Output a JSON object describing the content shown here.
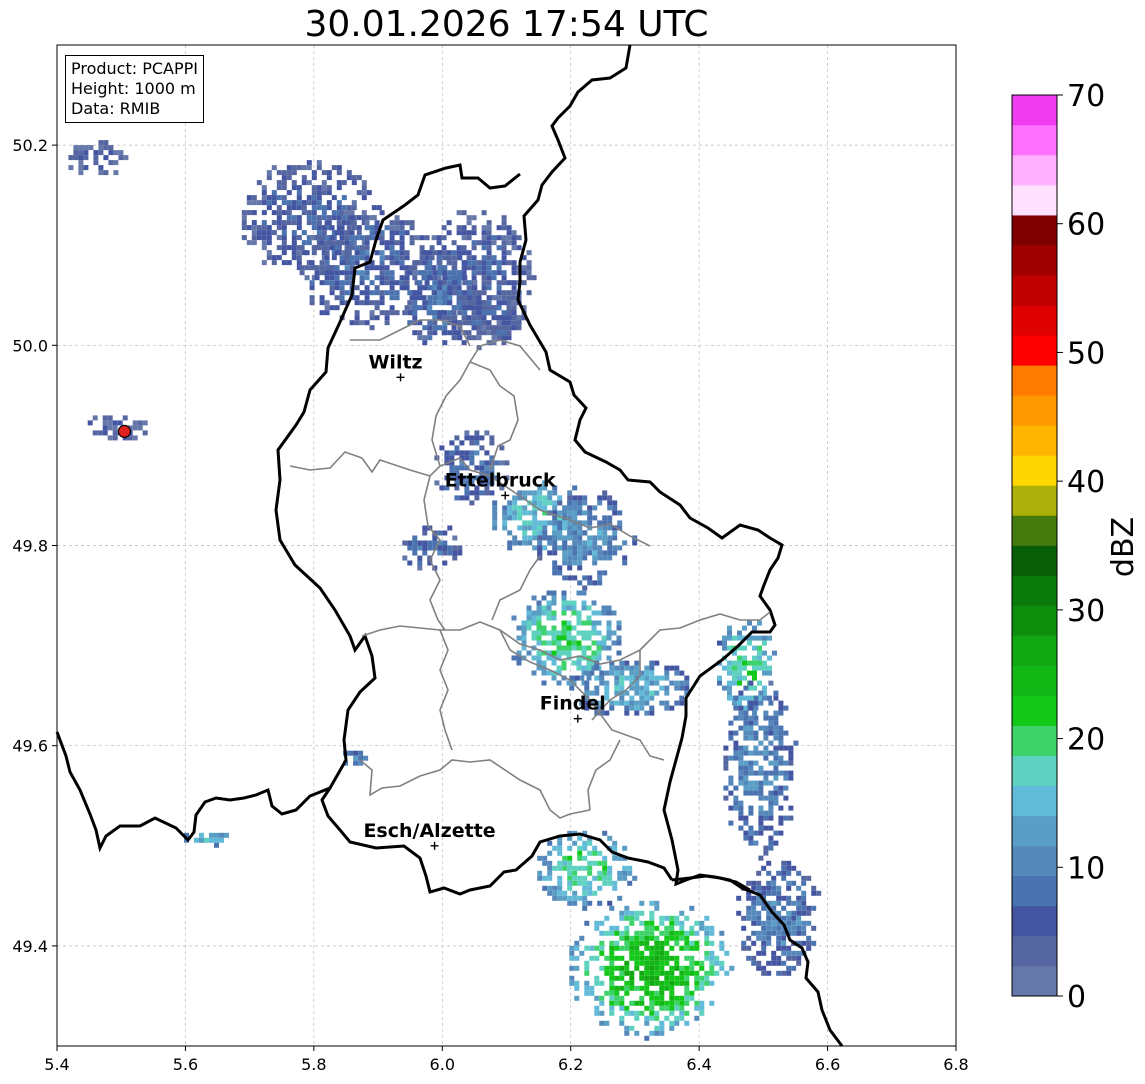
{
  "title": "30.01.2026 17:54 UTC",
  "info": {
    "product": "Product: PCAPPI",
    "height": "Height: 1000 m",
    "data": "Data: RMIB"
  },
  "axes": {
    "lon_range": [
      5.4,
      6.8
    ],
    "lat_range": [
      49.3,
      50.3
    ],
    "x_ticks": [
      "5.4",
      "5.6",
      "5.8",
      "6.0",
      "6.2",
      "6.4",
      "6.6",
      "6.8"
    ],
    "y_ticks": [
      "49.4",
      "49.6",
      "49.8",
      "50.0",
      "50.2"
    ],
    "grid": true
  },
  "cities": [
    {
      "name": "Wiltz",
      "lon": 5.935,
      "lat": 49.968
    },
    {
      "name": "Ettelbruck",
      "lon": 6.098,
      "lat": 49.85
    },
    {
      "name": "Findel",
      "lon": 6.211,
      "lat": 49.627
    },
    {
      "name": "Esch/Alzette",
      "lon": 5.988,
      "lat": 49.5
    }
  ],
  "radar_site": {
    "lon": 5.505,
    "lat": 49.914,
    "color": "#e02020"
  },
  "colorbar": {
    "label": "dBZ",
    "min": 0,
    "max": 70,
    "ticks": [
      "0",
      "10",
      "20",
      "30",
      "40",
      "50",
      "60",
      "70"
    ],
    "colors": [
      "#6677aa",
      "#5566a0",
      "#4455a2",
      "#4a73b0",
      "#5588bb",
      "#5a9dc5",
      "#60bad8",
      "#5ed1c0",
      "#3ed26a",
      "#14c81a",
      "#12b716",
      "#12a812",
      "#0d8f0d",
      "#0a7a0a",
      "#075e07",
      "#457a0d",
      "#adb00a",
      "#ffd700",
      "#ffb400",
      "#ff9900",
      "#ff7a00",
      "#ff0000",
      "#e00000",
      "#c00000",
      "#a00000",
      "#800000",
      "#ffe0ff",
      "#ffb0ff",
      "#ff70ff",
      "#f03cf0"
    ]
  },
  "map_features": {
    "country_border_color": "#000000",
    "canton_border_color": "#808080"
  },
  "precip_cells": [
    {
      "lon": 5.79,
      "lat": 50.13,
      "rlon": 0.11,
      "rlat": 0.06,
      "dbz": 6
    },
    {
      "lon": 5.88,
      "lat": 50.08,
      "rlon": 0.11,
      "rlat": 0.06,
      "dbz": 7
    },
    {
      "lon": 6.05,
      "lat": 50.07,
      "rlon": 0.09,
      "rlat": 0.07,
      "dbz": 6
    },
    {
      "lon": 5.99,
      "lat": 50.05,
      "rlon": 0.06,
      "rlat": 0.05,
      "dbz": 8
    },
    {
      "lon": 6.08,
      "lat": 50.03,
      "rlon": 0.05,
      "rlat": 0.03,
      "dbz": 6
    },
    {
      "lon": 5.46,
      "lat": 50.19,
      "rlon": 0.05,
      "rlat": 0.02,
      "dbz": 3
    },
    {
      "lon": 5.49,
      "lat": 49.92,
      "rlon": 0.05,
      "rlat": 0.015,
      "dbz": 4
    },
    {
      "lon": 6.04,
      "lat": 49.88,
      "rlon": 0.06,
      "rlat": 0.04,
      "dbz": 8
    },
    {
      "lon": 6.15,
      "lat": 49.83,
      "rlon": 0.08,
      "rlat": 0.04,
      "dbz": 17
    },
    {
      "lon": 6.22,
      "lat": 49.81,
      "rlon": 0.08,
      "rlat": 0.05,
      "dbz": 12
    },
    {
      "lon": 5.98,
      "lat": 49.8,
      "rlon": 0.05,
      "rlat": 0.025,
      "dbz": 8
    },
    {
      "lon": 6.19,
      "lat": 49.71,
      "rlon": 0.09,
      "rlat": 0.05,
      "dbz": 20
    },
    {
      "lon": 6.29,
      "lat": 49.66,
      "rlon": 0.1,
      "rlat": 0.03,
      "dbz": 15
    },
    {
      "lon": 6.47,
      "lat": 49.68,
      "rlon": 0.05,
      "rlat": 0.05,
      "dbz": 20
    },
    {
      "lon": 6.49,
      "lat": 49.58,
      "rlon": 0.06,
      "rlat": 0.09,
      "dbz": 11
    },
    {
      "lon": 6.22,
      "lat": 49.48,
      "rlon": 0.08,
      "rlat": 0.04,
      "dbz": 20
    },
    {
      "lon": 6.32,
      "lat": 49.38,
      "rlon": 0.13,
      "rlat": 0.07,
      "dbz": 25
    },
    {
      "lon": 6.52,
      "lat": 49.43,
      "rlon": 0.07,
      "rlat": 0.06,
      "dbz": 10
    },
    {
      "lon": 5.63,
      "lat": 49.51,
      "rlon": 0.04,
      "rlat": 0.008,
      "dbz": 15
    },
    {
      "lon": 5.86,
      "lat": 49.59,
      "rlon": 0.03,
      "rlat": 0.01,
      "dbz": 11
    }
  ]
}
